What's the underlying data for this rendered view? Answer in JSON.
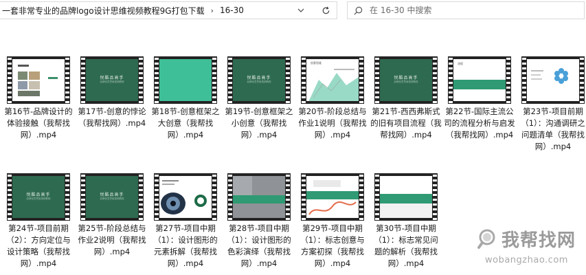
{
  "address": {
    "crumbs": [
      "一套非常专业的品牌logo设计思维视频教程9G打包下载",
      "16-30"
    ],
    "separator": "›"
  },
  "search": {
    "placeholder": "在 16-30 中搜索"
  },
  "files": [
    {
      "caption": "第16节-品牌设计的体验接触（我帮找网）.mp4",
      "frame": "white-photos"
    },
    {
      "caption": "第17节-创意的悖论（我帮找网）.mp4",
      "frame": "green-title",
      "frame_text": "悦酷品高手",
      "frame_sub": "品牌创意思维视频教程"
    },
    {
      "caption": "第18节-创意框架之大创意（我帮找网）.mp4",
      "frame": "teal"
    },
    {
      "caption": "第19节-创意框架之小创意（我帮找网）.mp4",
      "frame": "green-title",
      "frame_text": "悦酷品高手",
      "frame_sub": "品牌创意思维视频教程"
    },
    {
      "caption": "第20节-阶段总结与作业1说明（我帮找网）.mp4",
      "frame": "white-chart",
      "frame_text": "创意思维"
    },
    {
      "caption": "第21节-西西弗斯式的旧有项目流程（我帮找网）.mp4",
      "frame": "green-title",
      "frame_text": "悦酷品高手",
      "frame_sub": "品牌创意思维视频教程"
    },
    {
      "caption": "第22节-国际主流公司的流程分析与启发（我帮找网）.mp4",
      "frame": "white-banner",
      "frame_text": "流程"
    },
    {
      "caption": "第23节-项目前期（1）：沟通调研之问题清单（我帮找网）.mp4",
      "frame": "white-flower"
    },
    {
      "caption": "第24节-项目前期（2）：方向定位与设计策略（我帮找网）.mp4",
      "frame": "green-title",
      "frame_text": "悦酷品高手",
      "frame_sub": "品牌创意思维视频教程"
    },
    {
      "caption": "第25节-阶段总结与作业2说明（我帮找网）.mp4",
      "frame": "green-title",
      "frame_text": "悦酷品高手",
      "frame_sub": "品牌创意思维视频教程"
    },
    {
      "caption": "第27节-项目中期（1）：设计图形的元素拆解（我帮找网）.mp4",
      "frame": "white-eye"
    },
    {
      "caption": "第28节-项目中期（1）：设计图形的色彩演绎（我帮找网）.mp4",
      "frame": "grey-banner"
    },
    {
      "caption": "第29节-项目中期（1）：标志创意与方案初探（我帮找网）.mp4",
      "frame": "white-wave"
    },
    {
      "caption": "第30节-项目中期（1）：标志常见问题的解析（我帮找网）.mp4",
      "frame": "white-banner2"
    }
  ],
  "watermark": {
    "brand": "我帮找网",
    "url": "wobangzhao.com"
  },
  "colors": {
    "film": "#232323",
    "green": "#2e6a4f",
    "teal": "#3fbf97",
    "border": "#d9d9d9"
  }
}
